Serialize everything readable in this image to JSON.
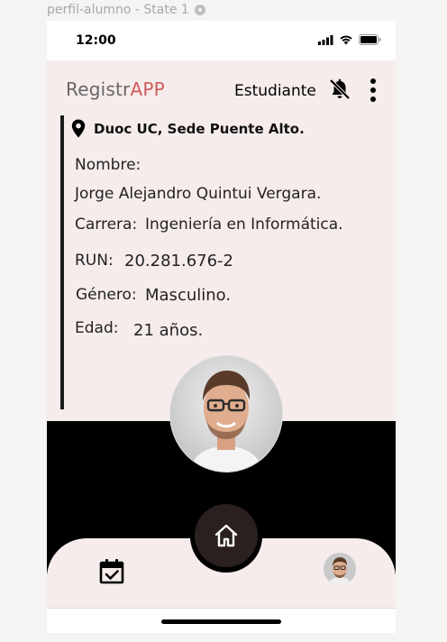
{
  "frame": {
    "label": "perfil-alumno - State 1"
  },
  "status_bar": {
    "time": "12:00"
  },
  "header": {
    "brand_primary": "Registr",
    "brand_accent": "APP",
    "role": "Estudiante"
  },
  "profile": {
    "location": "Duoc UC, Sede Puente Alto.",
    "name_label": "Nombre:",
    "name_value": "Jorge Alejandro Quintui Vergara.",
    "career_label": "Carrera:",
    "career_value": "Ingeniería en Informática.",
    "run_label": "RUN:",
    "run_value": "20.281.676-2",
    "gender_label": "Género:",
    "gender_value": "Masculino.",
    "age_label": "Edad:",
    "age_value": "21 años."
  },
  "icons": {
    "location": "map-pin-icon",
    "bell": "bell-off-icon",
    "menu": "more-vertical-icon",
    "home": "home-icon",
    "calendar": "calendar-check-icon"
  },
  "colors": {
    "brand_accent": "#cf5b5b",
    "content_background": "#f7ecec",
    "dark_band": "#000000",
    "home_button": "#2a201f"
  }
}
